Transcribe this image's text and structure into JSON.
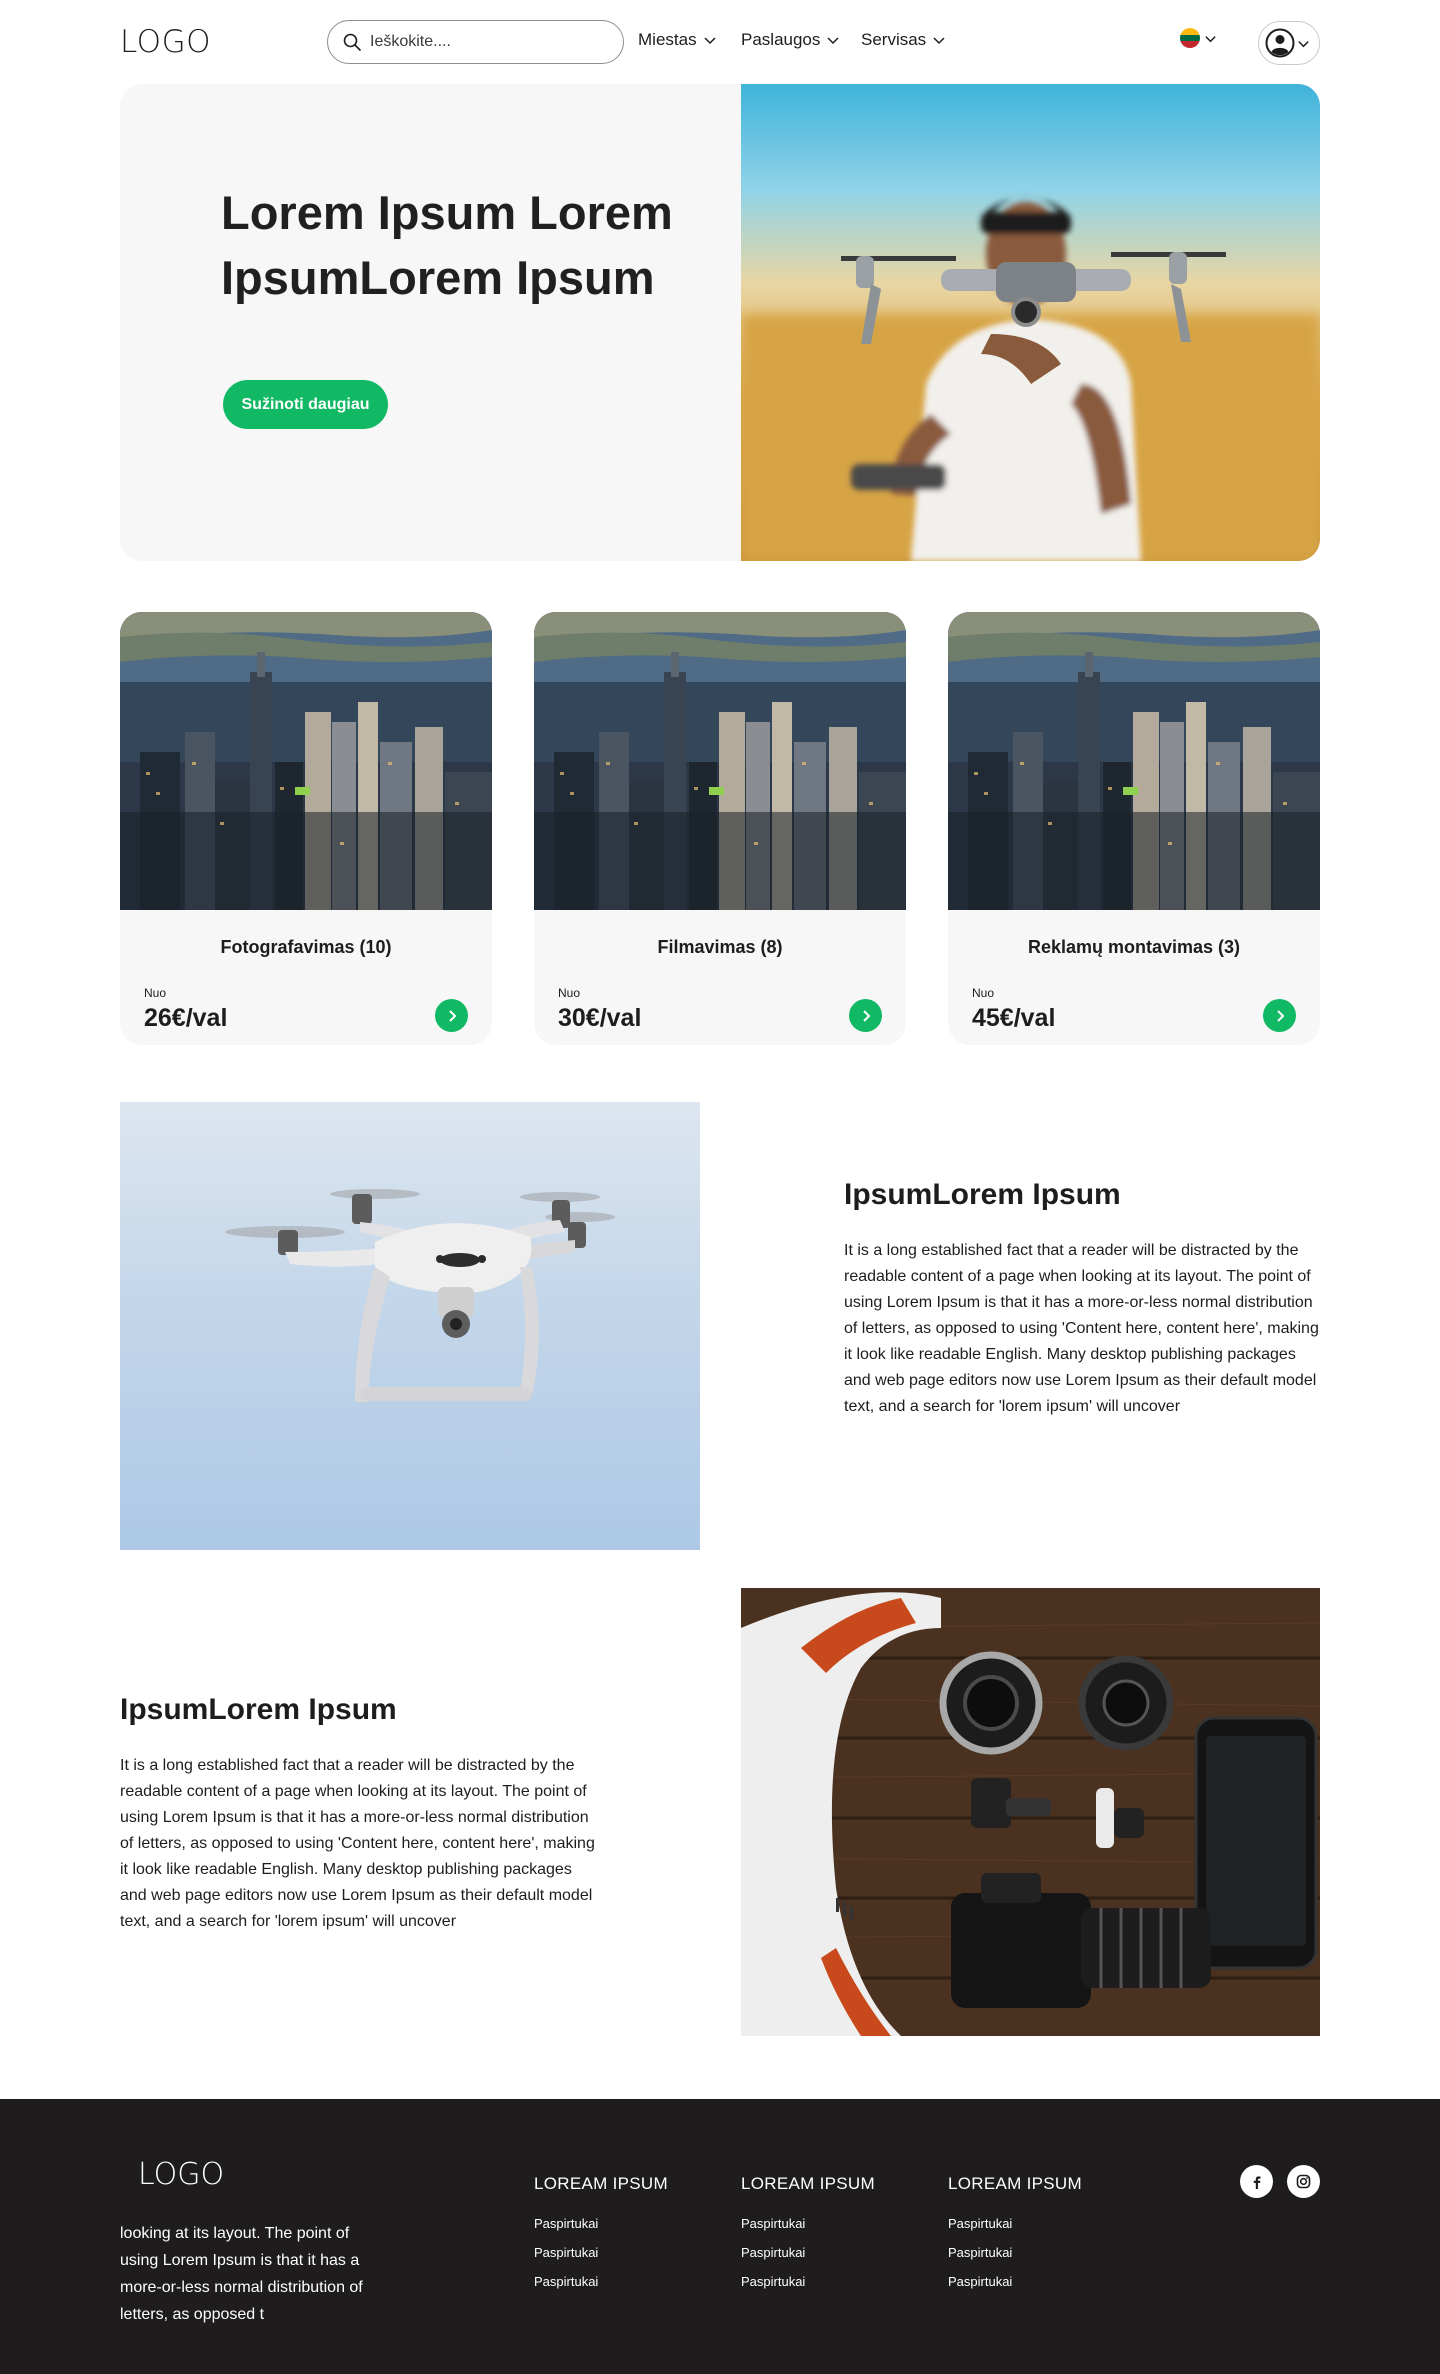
{
  "header": {
    "logo": "LOGO",
    "search_placeholder": "Ieškokite....",
    "nav": [
      {
        "label": "Miestas"
      },
      {
        "label": "Paslaugos"
      },
      {
        "label": "Servisas"
      }
    ]
  },
  "hero": {
    "title": "Lorem Ipsum Lorem IpsumLorem Ipsum",
    "button": "Sužinoti daugiau"
  },
  "cards": [
    {
      "title": "Fotografavimas (10)",
      "from": "Nuo",
      "price": "26€/val"
    },
    {
      "title": "Filmavimas (8)",
      "from": "Nuo",
      "price": "30€/val"
    },
    {
      "title": "Reklamų montavimas (3)",
      "from": "Nuo",
      "price": "45€/val"
    }
  ],
  "features": [
    {
      "title": "IpsumLorem Ipsum",
      "text": "It is a long established fact that a reader will be distracted by the readable content of a page when looking at its layout. The point of using Lorem Ipsum is that it has a more-or-less normal distribution of letters, as opposed to using 'Content here, content here', making it look like readable English. Many desktop publishing packages and web page editors now use Lorem Ipsum as their default model text, and a search for 'lorem ipsum' will uncover"
    },
    {
      "title": "IpsumLorem Ipsum",
      "text": "It is a long established fact that a reader will be distracted by the readable content of a page when looking at its layout. The point of using Lorem Ipsum is that it has a more-or-less normal distribution of letters, as opposed to using 'Content here, content here', making it look like readable English. Many desktop publishing packages and web page editors now use Lorem Ipsum as their default model text, and a search for 'lorem ipsum' will uncover"
    }
  ],
  "footer": {
    "logo": "LOGO",
    "text": "looking at its layout. The point of using Lorem Ipsum is that it has a more-or-less normal distribution of letters, as opposed t",
    "columns": [
      {
        "title": "LOREAM IPSUM",
        "links": [
          "Paspirtukai",
          "Paspirtukai",
          "Paspirtukai"
        ]
      },
      {
        "title": "LOREAM IPSUM",
        "links": [
          "Paspirtukai",
          "Paspirtukai",
          "Paspirtukai"
        ]
      },
      {
        "title": "LOREAM IPSUM",
        "links": [
          "Paspirtukai",
          "Paspirtukai",
          "Paspirtukai"
        ]
      }
    ],
    "social": [
      {
        "icon": "facebook-icon"
      },
      {
        "icon": "instagram-icon"
      }
    ]
  },
  "colors": {
    "accent": "#12b965",
    "dark": "#1f1c1d",
    "panel": "#f7f7f7"
  }
}
